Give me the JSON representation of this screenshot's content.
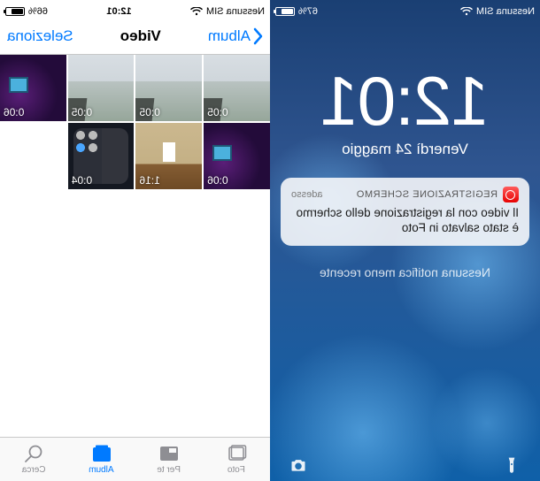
{
  "left": {
    "status": {
      "carrier": "Nessuna SIM",
      "battery_pct": "67%",
      "battery_fill_pct": 67
    },
    "clock": "12:01",
    "date": "Venerdì 24 maggio",
    "notification": {
      "app": "REGISTRAZIONE SCHERMO",
      "time": "adesso",
      "body": "Il video con la registrazione dello schermo è stato salvato in Foto"
    },
    "older_label": "Nessuna notifica meno recente"
  },
  "right": {
    "status": {
      "carrier": "Nessuna SIM",
      "time": "12:01",
      "battery_pct": "66%",
      "battery_fill_pct": 66
    },
    "nav": {
      "back": "Album",
      "title": "Video",
      "action": "Seleziona"
    },
    "videos": [
      {
        "duration": "0:05",
        "style": "art-sky"
      },
      {
        "duration": "0:05",
        "style": "art-sky"
      },
      {
        "duration": "0:05",
        "style": "art-sky"
      },
      {
        "duration": "0:06",
        "style": "art-purple"
      },
      {
        "duration": "0:06",
        "style": "art-purple"
      },
      {
        "duration": "1:16",
        "style": "art-room"
      },
      {
        "duration": "0:04",
        "style": "art-cc"
      }
    ],
    "tabs": {
      "photos": "Foto",
      "foryou": "Per te",
      "albums": "Album",
      "search": "Cerca"
    }
  }
}
